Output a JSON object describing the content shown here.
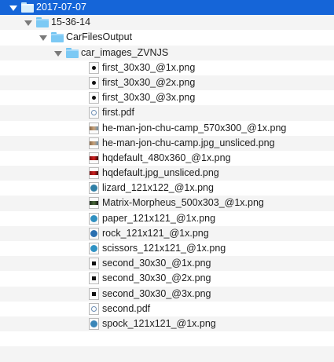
{
  "tree": {
    "rows": [
      {
        "label": "2017-07-07",
        "kind": "folder",
        "icon": "folder-icon",
        "expanded": true,
        "depth": 0,
        "selected": true
      },
      {
        "label": "15-36-14",
        "kind": "folder",
        "icon": "folder-icon",
        "expanded": true,
        "depth": 1
      },
      {
        "label": "CarFilesOutput",
        "kind": "folder",
        "icon": "folder-icon",
        "expanded": true,
        "depth": 2
      },
      {
        "label": "car_images_ZVNJS",
        "kind": "folder",
        "icon": "folder-icon",
        "expanded": true,
        "depth": 3
      },
      {
        "label": "first_30x30_@1x.png",
        "kind": "file",
        "icon": "dot-image-icon",
        "depth": 4
      },
      {
        "label": "first_30x30_@2x.png",
        "kind": "file",
        "icon": "dot-image-icon",
        "depth": 4
      },
      {
        "label": "first_30x30_@3x.png",
        "kind": "file",
        "icon": "dot-image-icon",
        "depth": 4
      },
      {
        "label": "first.pdf",
        "kind": "file",
        "icon": "pdf-icon",
        "depth": 4
      },
      {
        "label": "he-man-jon-chu-camp_570x300_@1x.png",
        "kind": "file",
        "icon": "photo-thumbnail-icon",
        "depth": 4
      },
      {
        "label": "he-man-jon-chu-camp.jpg_unsliced.png",
        "kind": "file",
        "icon": "photo-thumbnail-icon",
        "depth": 4
      },
      {
        "label": "hqdefault_480x360_@1x.png",
        "kind": "file",
        "icon": "red-thumbnail-icon",
        "depth": 4
      },
      {
        "label": "hqdefault.jpg_unsliced.png",
        "kind": "file",
        "icon": "red-thumbnail-icon",
        "depth": 4
      },
      {
        "label": "lizard_121x122_@1x.png",
        "kind": "file",
        "icon": "lizard-thumbnail-icon",
        "depth": 4
      },
      {
        "label": "Matrix-Morpheus_500x303_@1x.png",
        "kind": "file",
        "icon": "matrix-thumbnail-icon",
        "depth": 4
      },
      {
        "label": "paper_121x121_@1x.png",
        "kind": "file",
        "icon": "paper-thumbnail-icon",
        "depth": 4
      },
      {
        "label": "rock_121x121_@1x.png",
        "kind": "file",
        "icon": "rock-thumbnail-icon",
        "depth": 4
      },
      {
        "label": "scissors_121x121_@1x.png",
        "kind": "file",
        "icon": "scissors-thumbnail-icon",
        "depth": 4
      },
      {
        "label": "second_30x30_@1x.png",
        "kind": "file",
        "icon": "square-image-icon",
        "depth": 4
      },
      {
        "label": "second_30x30_@2x.png",
        "kind": "file",
        "icon": "square-image-icon",
        "depth": 4
      },
      {
        "label": "second_30x30_@3x.png",
        "kind": "file",
        "icon": "square-image-icon",
        "depth": 4
      },
      {
        "label": "second.pdf",
        "kind": "file",
        "icon": "pdf-icon",
        "depth": 4
      },
      {
        "label": "spock_121x121_@1x.png",
        "kind": "file",
        "icon": "spock-thumbnail-icon",
        "depth": 4
      },
      {
        "label": "",
        "kind": "empty",
        "depth": 0
      },
      {
        "label": "",
        "kind": "empty",
        "depth": 0
      }
    ]
  },
  "colors": {
    "selection": "#1565d8",
    "stripe": "#f4f4f4",
    "folder": "#7cc9f4",
    "disclosure": "#7a7a7a"
  }
}
